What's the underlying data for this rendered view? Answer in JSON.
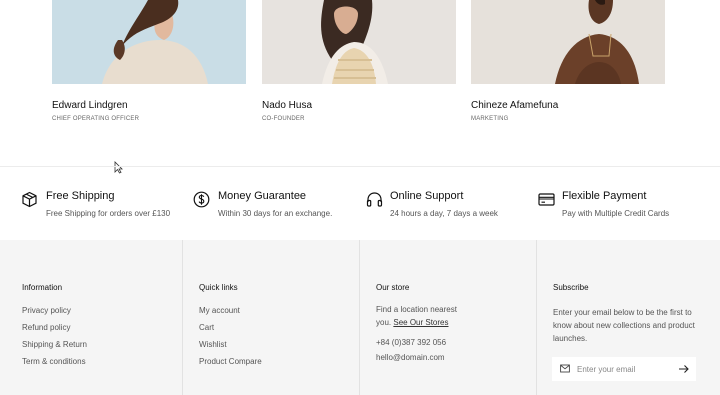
{
  "team": [
    {
      "name": "Edward Lindgren",
      "role": "CHIEF OPERATING OFFICER"
    },
    {
      "name": "Nado Husa",
      "role": "CO-FOUNDER"
    },
    {
      "name": "Chineze Afamefuna",
      "role": "MARKETING"
    }
  ],
  "features": [
    {
      "icon": "box-icon",
      "title": "Free Shipping",
      "desc": "Free Shipping for orders over £130"
    },
    {
      "icon": "dollar-icon",
      "title": "Money Guarantee",
      "desc": "Within 30 days for an exchange."
    },
    {
      "icon": "headphones-icon",
      "title": "Online Support",
      "desc": "24 hours a day, 7 days a week"
    },
    {
      "icon": "credit-card-icon",
      "title": "Flexible Payment",
      "desc": "Pay with Multiple Credit Cards"
    }
  ],
  "footer": {
    "information": {
      "title": "Information",
      "links": [
        "Privacy policy",
        "Refund policy",
        "Shipping & Return",
        "Term & conditions"
      ]
    },
    "quick_links": {
      "title": "Quick links",
      "links": [
        "My account",
        "Cart",
        "Wishlist",
        "Product Compare"
      ]
    },
    "store": {
      "title": "Our store",
      "line1": "Find a location nearest",
      "line2_prefix": "you.",
      "link": "See Our Stores",
      "phone": "+84 (0)387 392 056",
      "email": "hello@domain.com"
    },
    "subscribe": {
      "title": "Subscribe",
      "text": "Enter your email below to be the first to know about new collections and product launches.",
      "placeholder": "Enter your email"
    }
  }
}
